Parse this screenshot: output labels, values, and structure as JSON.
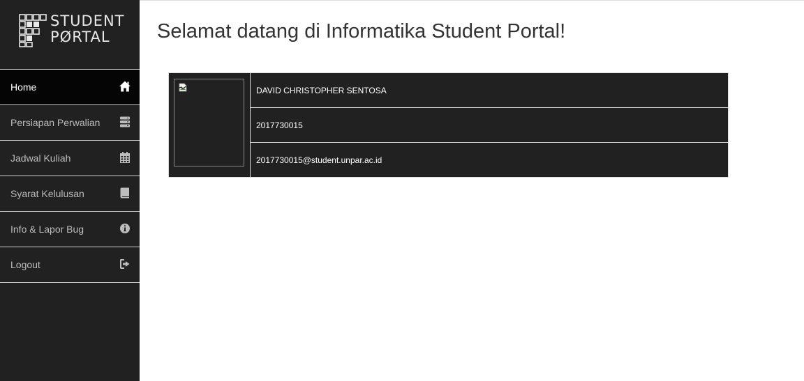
{
  "sidebar": {
    "logo": {
      "line1": "STUDENT",
      "line2": "PØRTAL",
      "icon": "informatika-f-logo"
    },
    "items": [
      {
        "label": "Home",
        "icon": "home-icon",
        "active": true
      },
      {
        "label": "Persiapan Perwalian",
        "icon": "server-icon",
        "active": false
      },
      {
        "label": "Jadwal Kuliah",
        "icon": "calendar-icon",
        "active": false
      },
      {
        "label": "Syarat Kelulusan",
        "icon": "book-icon",
        "active": false
      },
      {
        "label": "Info & Lapor Bug",
        "icon": "info-circle-icon",
        "active": false
      },
      {
        "label": "Logout",
        "icon": "sign-out-icon",
        "active": false
      }
    ]
  },
  "main": {
    "title": "Selamat datang di Informatika Student Portal!"
  },
  "profile": {
    "photo": "broken-image-icon",
    "name": "DAVID CHRISTOPHER SENTOSA",
    "npm": "2017730015",
    "email": "2017730015@student.unpar.ac.id"
  },
  "colors": {
    "sidebar_bg": "#212121",
    "active_bg": "#050505",
    "table_bg": "#212121",
    "menu_text": "#bdbdbd",
    "title_text": "#333333"
  }
}
